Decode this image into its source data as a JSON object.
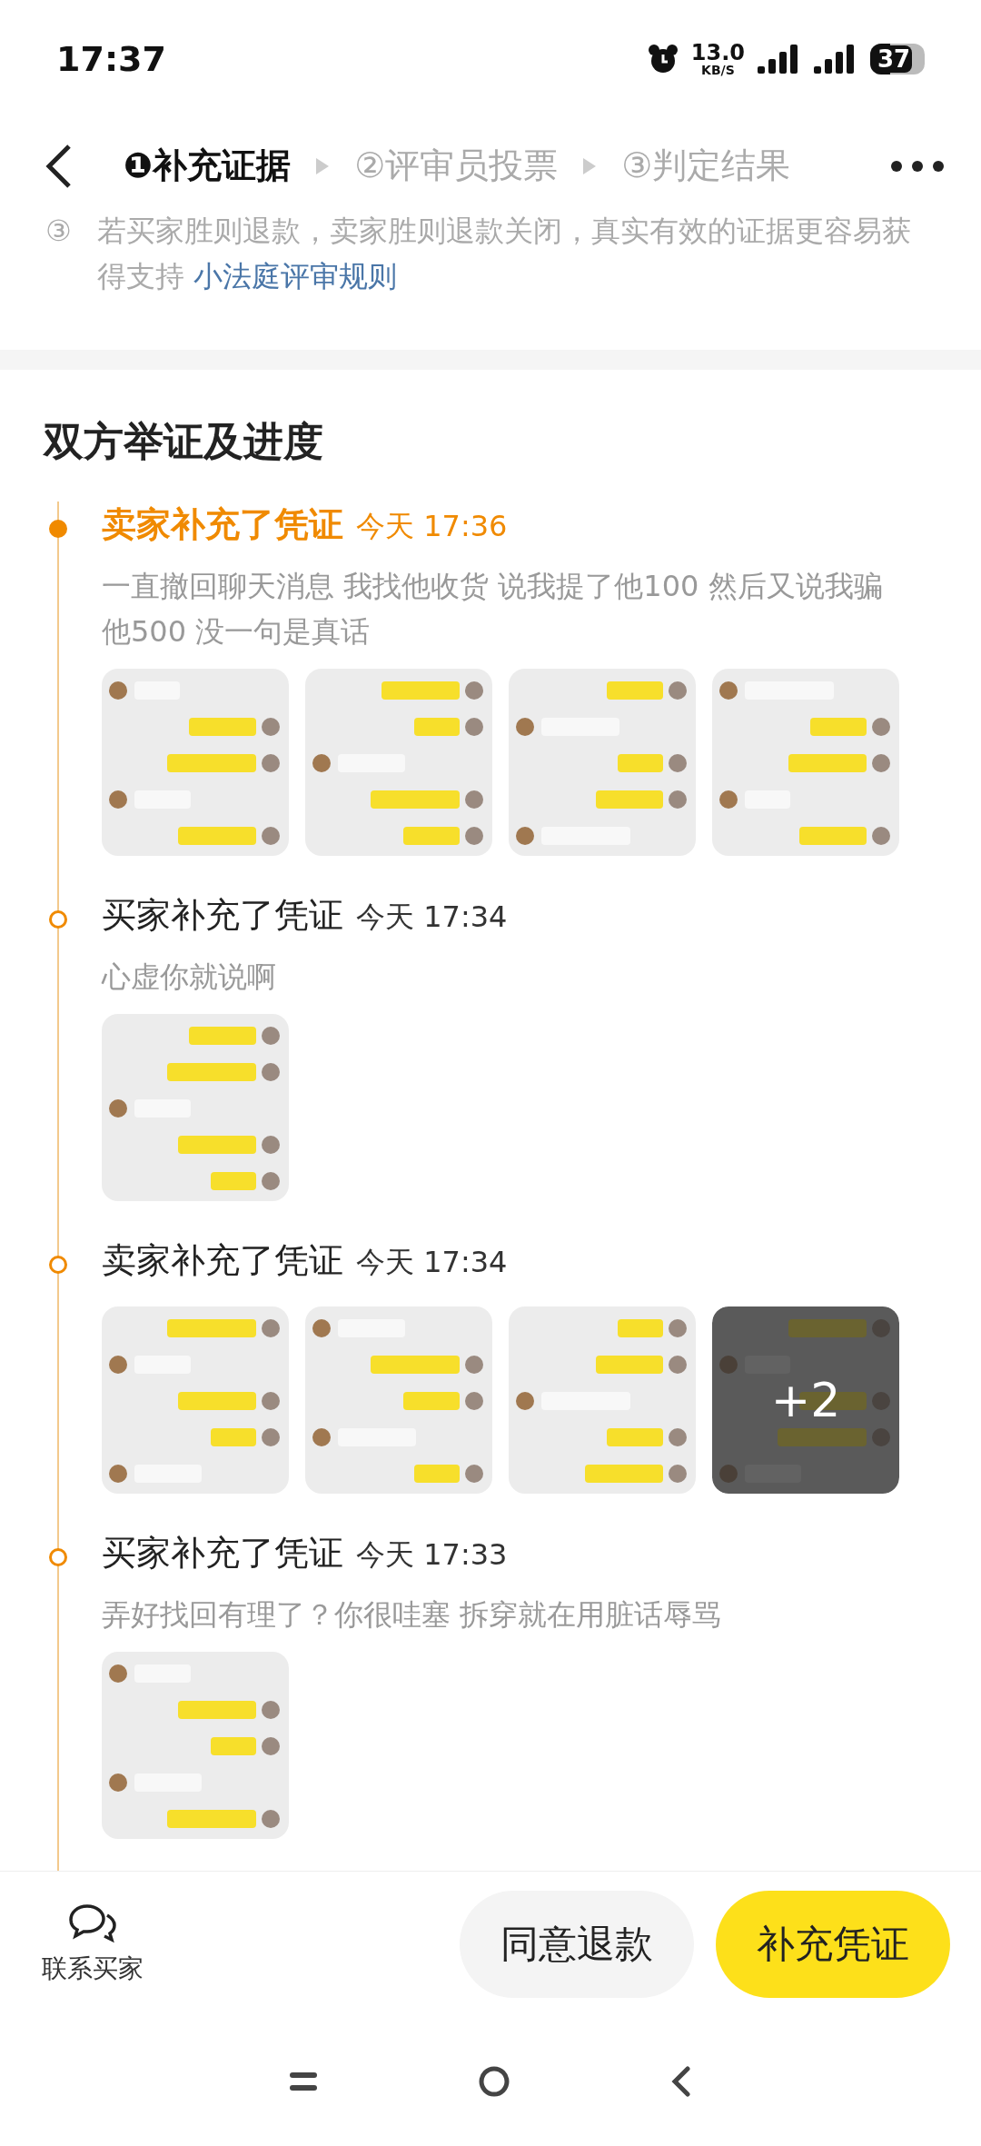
{
  "status_bar": {
    "time": "17:37",
    "speed_value": "13.0",
    "speed_unit": "KB/S",
    "battery": "37"
  },
  "header": {
    "steps": [
      {
        "label": "❶补充证据",
        "selected": true
      },
      {
        "label": "②评审员投票",
        "selected": false
      },
      {
        "label": "③判定结果",
        "selected": false
      }
    ]
  },
  "notice": {
    "marker": "③",
    "text": "若买家胜则退款，卖家胜则退款关闭，真实有效的证据更容易获得支持",
    "link": "小法庭评审规则"
  },
  "section_title": "双方举证及进度",
  "timeline": [
    {
      "title": "卖家补充了凭证",
      "time": "今天 17:36",
      "active": true,
      "description": "一直撤回聊天消息 我找他收货 说我提了他100 然后又说我骗他500 没一句是真话",
      "images": [
        {
          "kind": "chat"
        },
        {
          "kind": "chat"
        },
        {
          "kind": "chat"
        },
        {
          "kind": "chat"
        }
      ]
    },
    {
      "title": "买家补充了凭证",
      "time": "今天 17:34",
      "active": false,
      "description": "心虚你就说啊",
      "images": [
        {
          "kind": "chat"
        }
      ]
    },
    {
      "title": "卖家补充了凭证",
      "time": "今天 17:34",
      "active": false,
      "images": [
        {
          "kind": "chat"
        },
        {
          "kind": "chat"
        },
        {
          "kind": "chat"
        },
        {
          "kind": "chat",
          "overlay": "+2"
        }
      ]
    },
    {
      "title": "买家补充了凭证",
      "time": "今天 17:33",
      "active": false,
      "description": "弄好找回有理了？你很哇塞 拆穿就在用脏话辱骂",
      "images": [
        {
          "kind": "chat"
        }
      ]
    }
  ],
  "bottom_bar": {
    "contact": "联系买家",
    "buttons": [
      {
        "label": "同意退款",
        "kind": "secondary"
      },
      {
        "label": "补充凭证",
        "kind": "primary"
      }
    ]
  }
}
